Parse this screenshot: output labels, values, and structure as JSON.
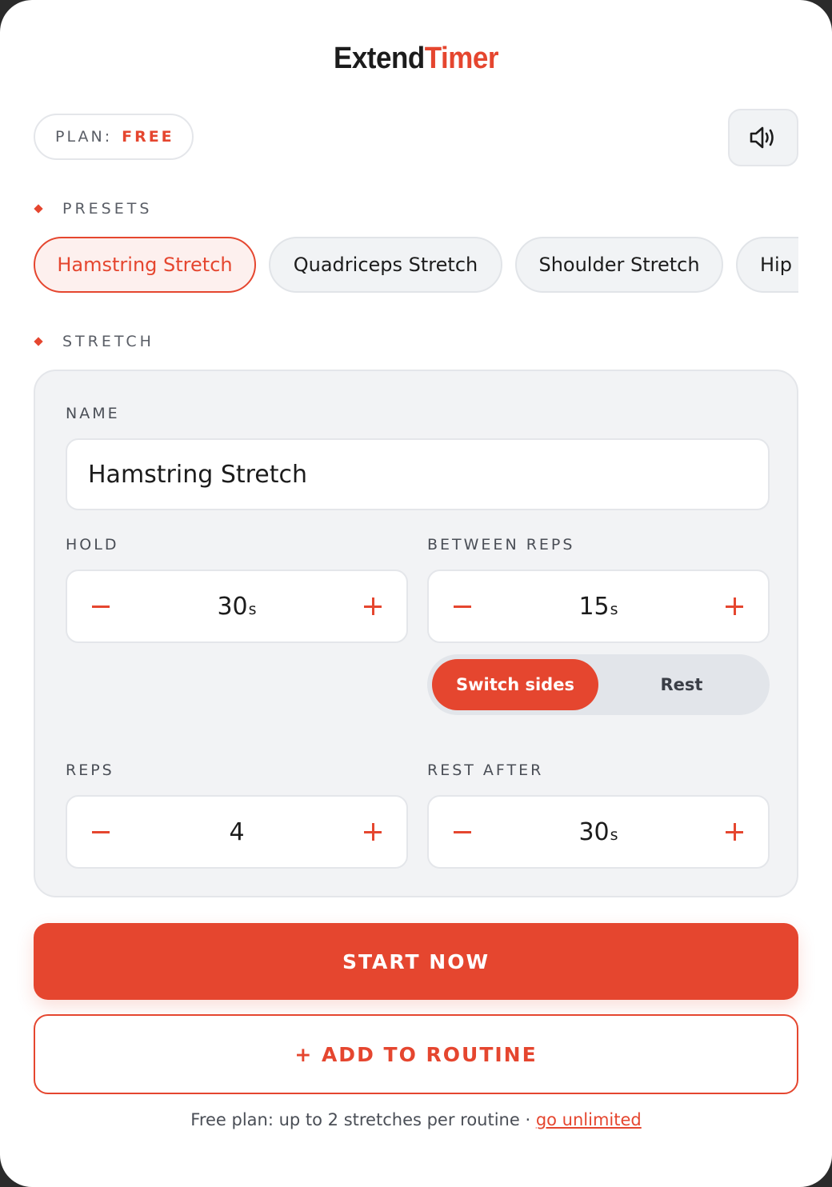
{
  "app": {
    "logo_part1": "Extend",
    "logo_part2": "Timer"
  },
  "plan": {
    "label": "PLAN:",
    "tier": "FREE"
  },
  "sound_button": {
    "icon": "speaker-icon"
  },
  "presets": {
    "label": "PRESETS",
    "items": [
      "Hamstring Stretch",
      "Quadriceps Stretch",
      "Shoulder Stretch",
      "Hip"
    ],
    "active": "Hamstring Stretch"
  },
  "stretch": {
    "label": "STRETCH",
    "name_label": "NAME",
    "name_value": "Hamstring Stretch",
    "hold": {
      "label": "HOLD",
      "value": "30",
      "unit": "s"
    },
    "between_reps": {
      "label": "BETWEEN REPS",
      "value": "15",
      "unit": "s"
    },
    "between_mode": {
      "options": [
        "Switch sides",
        "Rest"
      ],
      "selected": "Switch sides"
    },
    "reps": {
      "label": "REPS",
      "value": "4"
    },
    "rest_after": {
      "label": "REST AFTER",
      "value": "30",
      "unit": "s"
    }
  },
  "actions": {
    "start": "START NOW",
    "add_to_routine": "+ ADD TO ROUTINE"
  },
  "footer": {
    "text": "Free plan: up to 2 stretches per routine · ",
    "link": "go unlimited"
  },
  "colors": {
    "accent": "#e5462f",
    "panel": "#f2f3f5",
    "text": "#1c1c1c"
  }
}
